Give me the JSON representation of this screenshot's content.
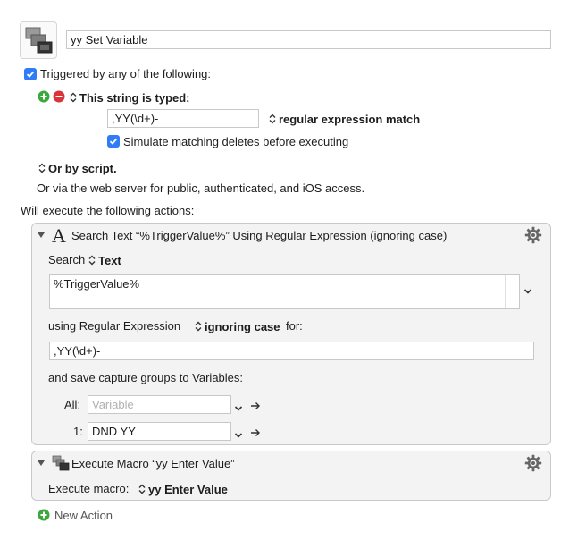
{
  "macro": {
    "name": "yy Set Variable"
  },
  "trigger": {
    "header": "Triggered by any of the following:",
    "string_trigger_label": "This string is typed:",
    "string_value": ",YY(\\d+)-",
    "match_type": "regular expression match",
    "simulate_label": "Simulate matching deletes before executing",
    "script_label": "Or by script.",
    "web_server_text": "Or via the web server for public, authenticated, and iOS access."
  },
  "actions_header": "Will execute the following actions:",
  "action1": {
    "title": "Search Text “%TriggerValue%” Using Regular Expression (ignoring case)",
    "search_label": "Search",
    "search_source": "Text",
    "search_text": "%TriggerValue%",
    "using_label": "using Regular Expression",
    "case_option": "ignoring case",
    "for_label": "for:",
    "regex_value": ",YY(\\d+)-",
    "capture_label": "and save capture groups to Variables:",
    "all_label": "All:",
    "all_placeholder": "Variable",
    "one_label": "1:",
    "one_value": "DND YY"
  },
  "action2": {
    "title": "Execute Macro “yy Enter Value”",
    "execute_label": "Execute macro:",
    "macro_value": "yy Enter Value"
  },
  "new_action_label": "New Action",
  "colors": {
    "accent_blue": "#2f7cf6",
    "add_green": "#3aa83a",
    "remove_red": "#d9343a",
    "panel_bg": "#f3f3f3"
  }
}
